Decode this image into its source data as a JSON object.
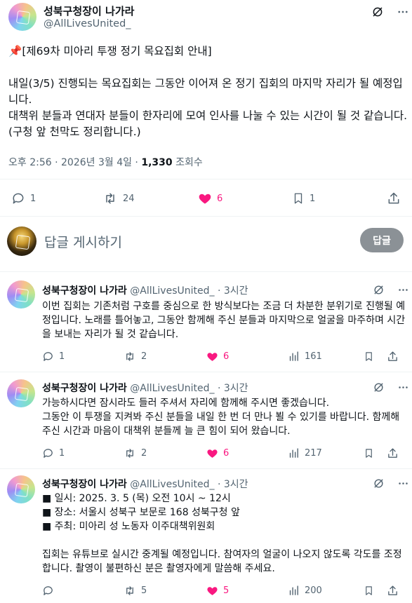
{
  "post": {
    "author_name": "성북구청장이 나가라",
    "author_handle": "@AllLivesUnited_",
    "pin_emoji": "📌",
    "title": "[제69차 미아리 투쟁 정기 목요집회 안내]",
    "paragraph1": "내일(3/5) 진행되는 목요집회는 그동안 이어져 온 정기 집회의 마지막 자리가 될 예정입니다.",
    "paragraph2": "대책위 분들과 연대자 분들이 한자리에 모여 인사를 나눌 수 있는 시간이 될 것 같습니다. (구청 앞 천막도 정리합니다.)",
    "time": "오후 2:56 · 2026년 3월 4일 · ",
    "views_count": "1,330",
    "views_label": " 조회수",
    "replies": "1",
    "reposts": "24",
    "likes": "6",
    "bookmarks": "1"
  },
  "compose": {
    "placeholder": "답글 게시하기",
    "button": "답글"
  },
  "replies": [
    {
      "name": "성북구청장이 나가라",
      "handle": "@AllLivesUnited_",
      "time": " · 3시간",
      "text": "이번 집회는 기존처럼 구호를 중심으로 한 방식보다는 조금 더 차분한 분위기로 진행될 예정입니다. 노래를 틀어놓고, 그동안 함께해 주신 분들과 마지막으로 얼굴을 마주하며 시간을 보내는 자리가 될 것 같습니다.",
      "replies": "1",
      "reposts": "2",
      "likes": "6",
      "views": "161"
    },
    {
      "name": "성북구청장이 나가라",
      "handle": "@AllLivesUnited_",
      "time": " · 3시간",
      "text": "가능하시다면 잠시라도 들러 주셔서 자리에 함께해 주시면 좋겠습니다.\n그동안 이 투쟁을 지켜봐 주신 분들을 내일 한 번 더 만나 뵐 수 있기를 바랍니다. 함께해 주신 시간과 마음이 대책위 분들께 늘 큰 힘이 되어 왔습니다.",
      "replies": "1",
      "reposts": "2",
      "likes": "6",
      "views": "217"
    },
    {
      "name": "성북구청장이 나가라",
      "handle": "@AllLivesUnited_",
      "time": " · 3시간",
      "text": "■ 일시: 2025. 3. 5 (목) 오전 10시 ~ 12시\n■ 장소: 서울시 성북구 보문로 168 성북구청 앞\n■ 주최: 미아리 성 노동자 이주대책위원회\n\n집회는 유튜브로 실시간 중계될 예정입니다. 참여자의 얼굴이 나오지 않도록 각도를 조정합니다. 촬영이 불편하신 분은 촬영자에게 말씀해 주세요.",
      "replies": "",
      "reposts": "5",
      "likes": "5",
      "views": "200"
    }
  ],
  "colors": {
    "text": "#0f1419",
    "muted": "#536471",
    "like": "#f91880",
    "divider": "#eff3f4",
    "reply_button": "#8b9196"
  }
}
